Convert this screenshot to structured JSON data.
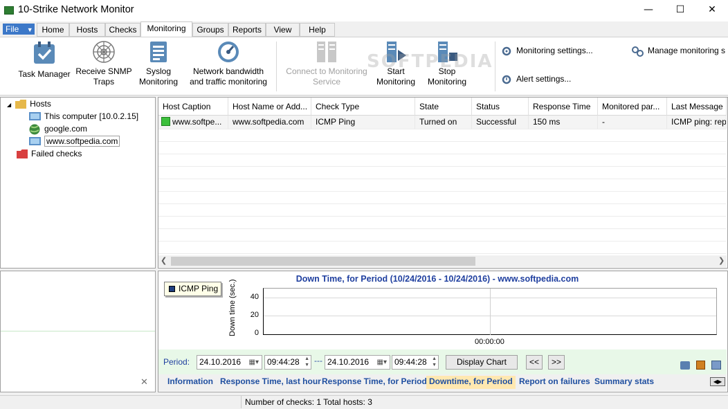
{
  "window": {
    "title": "10-Strike Network Monitor",
    "minimize": "—",
    "maximize": "☐",
    "close": "✕"
  },
  "menu": {
    "file": "File",
    "tabs": [
      "Home",
      "Hosts",
      "Checks",
      "Monitoring",
      "Groups",
      "Reports",
      "View",
      "Help"
    ],
    "active_tab": "Monitoring"
  },
  "ribbon": {
    "task_manager": "Task Manager",
    "snmp_line1": "Receive SNMP",
    "snmp_line2": "Traps",
    "syslog_line1": "Syslog",
    "syslog_line2": "Monitoring",
    "bw_line1": "Network bandwidth",
    "bw_line2": "and traffic monitoring",
    "connect_line1": "Connect to Monitoring",
    "connect_line2": "Service",
    "start_line1": "Start",
    "start_line2": "Monitoring",
    "stop_line1": "Stop",
    "stop_line2": "Monitoring",
    "monitoring_settings": "Monitoring settings...",
    "alert_settings": "Alert settings...",
    "manage_monitoring": "Manage monitoring s"
  },
  "tree": {
    "hosts": "Hosts",
    "this_computer": "This computer [10.0.2.15]",
    "google": "google.com",
    "softpedia": "www.softpedia.com",
    "failed": "Failed checks"
  },
  "grid": {
    "columns": [
      "Host Caption",
      "Host Name or Add...",
      "Check Type",
      "State",
      "Status",
      "Response Time",
      "Monitored par...",
      "Last Message"
    ],
    "rows": [
      [
        "www.softpe...",
        "www.softpedia.com",
        "ICMP Ping",
        "Turned on",
        "Successful",
        "150 ms",
        "-",
        "ICMP ping: repl"
      ]
    ]
  },
  "chart_data": {
    "type": "bar",
    "title": "Down Time,  for Period  (10/24/2016 - 10/24/2016) - www.softpedia.com",
    "ylabel": "Down time (sec.)",
    "xlabel": "",
    "ylim": [
      0,
      50
    ],
    "yticks": [
      "40",
      "20",
      "0"
    ],
    "x_ticks": [
      "00:00:00"
    ],
    "legend_position": "top-left",
    "series": [
      {
        "name": "ICMP Ping",
        "values": [
          0
        ]
      }
    ],
    "grid": true,
    "colors": {
      "series": "#1f3f7f",
      "title": "#1f3f9f"
    }
  },
  "period": {
    "label": "Period:",
    "from_date": "24.10.2016",
    "from_time": "09:44:28",
    "dash": "---",
    "to_date": "24.10.2016",
    "to_time": "09:44:28",
    "display_chart": "Display Chart",
    "prev": "<<",
    "next": ">>"
  },
  "bottom_tabs": [
    "Information",
    "Response Time, last hour",
    "Response Time, for Period",
    "Downtime, for Period",
    "Report on failures",
    "Summary stats"
  ],
  "active_bottom_tab": "Downtime, for Period",
  "status": {
    "text": "Number of checks: 1  Total hosts: 3"
  },
  "watermark": "SOFTPEDIA"
}
